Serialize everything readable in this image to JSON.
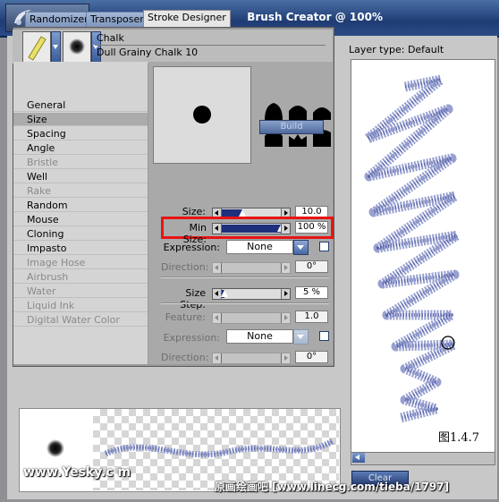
{
  "window": {
    "title": "Brush Creator @ 100%"
  },
  "tabs": [
    {
      "label": "Randomizer"
    },
    {
      "label": "Transposer"
    },
    {
      "label": "Stroke Designer"
    }
  ],
  "brush": {
    "category": "Chalk",
    "variant": "Dull Grainy Chalk 10"
  },
  "dabs": [
    {
      "label": "General"
    },
    {
      "label": "Size"
    },
    {
      "label": "Spacing"
    },
    {
      "label": "Angle"
    },
    {
      "label": "Bristle"
    },
    {
      "label": "Well"
    },
    {
      "label": "Rake"
    },
    {
      "label": "Random"
    },
    {
      "label": "Mouse"
    },
    {
      "label": "Cloning"
    },
    {
      "label": "Impasto"
    },
    {
      "label": "Image Hose"
    },
    {
      "label": "Airbrush"
    },
    {
      "label": "Water"
    },
    {
      "label": "Liquid Ink"
    },
    {
      "label": "Digital Water Color"
    }
  ],
  "size_panel": {
    "build_label": "Build",
    "size": {
      "label": "Size:",
      "value": "10.0",
      "level": 0.35
    },
    "min_size": {
      "label": "Min Size:",
      "value": "100 %",
      "level": 1.0
    },
    "expression1": {
      "label": "Expression:",
      "value": "None"
    },
    "direction1": {
      "label": "Direction:",
      "value": "0°"
    },
    "size_step": {
      "label": "Size Step:",
      "value": "5 %",
      "level": 0.05
    },
    "feature": {
      "label": "Feature:",
      "value": "1.0"
    },
    "expression2": {
      "label": "Expression:",
      "value": "None"
    },
    "direction2": {
      "label": "Direction:",
      "value": "0°"
    }
  },
  "canvas": {
    "layer_type": "Layer type: Default",
    "clear_label": "Clear",
    "figure_label": "图1.4.7"
  },
  "watermarks": {
    "left": "www.Yesky.c m",
    "right": "原画绘画吧 [www.linecg.com/tieba/1797]"
  },
  "colors": {
    "title_bar": "#2b4a84",
    "highlight": "#e81414",
    "stroke": "#4d5aa6"
  }
}
